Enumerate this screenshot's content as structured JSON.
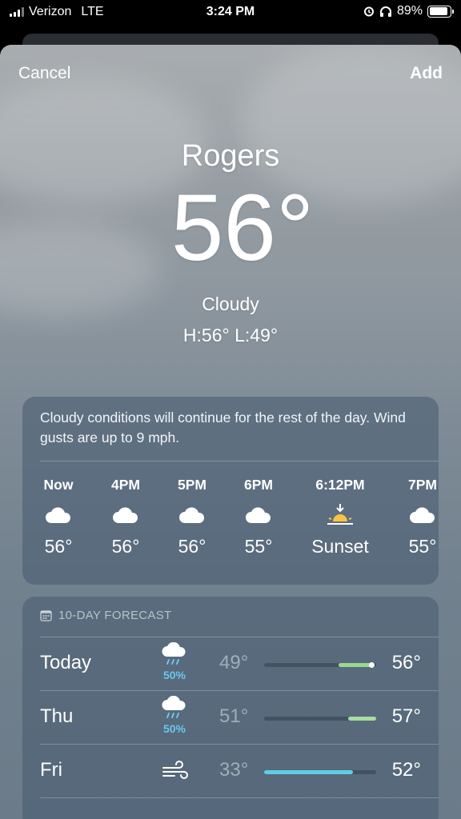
{
  "status_bar": {
    "carrier": "Verizon",
    "network": "LTE",
    "time": "3:24 PM",
    "battery": "89%",
    "battery_level": 0.89
  },
  "nav": {
    "cancel_label": "Cancel",
    "add_label": "Add"
  },
  "current": {
    "city": "Rogers",
    "temperature": "56°",
    "condition": "Cloudy",
    "high_low": "H:56°  L:49°"
  },
  "hourly": {
    "summary": "Cloudy conditions will continue for the rest of the day. Wind gusts are up to 9 mph.",
    "hours": [
      {
        "label": "Now",
        "icon": "cloud-icon",
        "value": "56°"
      },
      {
        "label": "4PM",
        "icon": "cloud-icon",
        "value": "56°"
      },
      {
        "label": "5PM",
        "icon": "cloud-icon",
        "value": "56°"
      },
      {
        "label": "6PM",
        "icon": "cloud-icon",
        "value": "55°"
      },
      {
        "label": "6:12PM",
        "icon": "sunset-icon",
        "value": "Sunset"
      },
      {
        "label": "7PM",
        "icon": "cloud-icon",
        "value": "55°"
      }
    ]
  },
  "forecast": {
    "header": "10-DAY FORECAST",
    "range": [
      33,
      57
    ],
    "days": [
      {
        "day": "Today",
        "icon": "rain-cloud-icon",
        "precip": "50%",
        "low": "49°",
        "high": "56°",
        "low_value": 49,
        "high_value": 56,
        "current_value": 56,
        "bar_color": "#9bd88f"
      },
      {
        "day": "Thu",
        "icon": "rain-cloud-icon",
        "precip": "50%",
        "low": "51°",
        "high": "57°",
        "low_value": 51,
        "high_value": 57,
        "bar_color": "#a9dca0"
      },
      {
        "day": "Fri",
        "icon": "wind-icon",
        "precip": "",
        "low": "33°",
        "high": "52°",
        "low_value": 33,
        "high_value": 52,
        "bar_color": "#5fcde6"
      }
    ]
  }
}
